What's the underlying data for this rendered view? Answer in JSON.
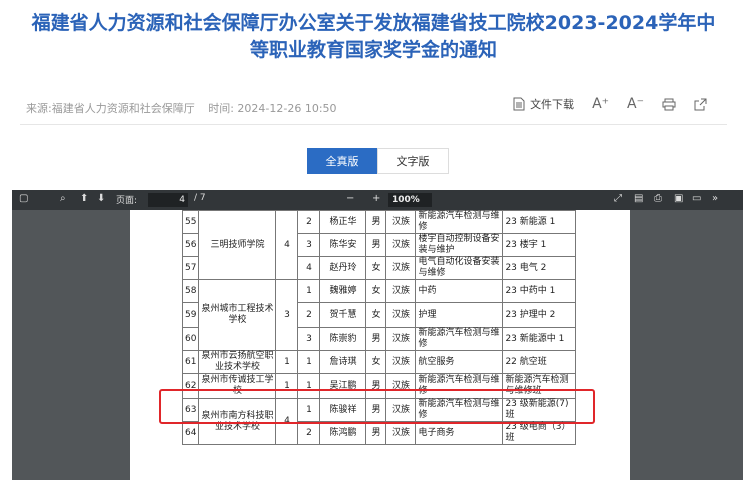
{
  "article": {
    "title_line1": "福建省人力资源和社会保障厅办公室关于发放福建省技工院校2023-2024学年中",
    "title_line2": "等职业教育国家奖学金的通知",
    "source": "来源:福建省人力资源和社会保障厅",
    "time": "时间:  2024-12-26 10:50"
  },
  "tools": {
    "download_label": "文件下载",
    "font_increase": "A⁺",
    "font_decrease": "A⁻"
  },
  "tabs": {
    "original": "全真版",
    "text": "文字版"
  },
  "viewer": {
    "page_label": "页面:",
    "page_current": "4",
    "page_total": "/ 7",
    "zoom": "100%"
  },
  "table_rows": [
    {
      "no": "55",
      "school": "三明技师学院",
      "count": "4",
      "idx": "2",
      "name": "杨正华",
      "sex": "男",
      "nation": "汉族",
      "major": "新能源汽车检测与维修",
      "cls": "23 新能源 1"
    },
    {
      "no": "56",
      "school": "",
      "count": "",
      "idx": "3",
      "name": "陈华安",
      "sex": "男",
      "nation": "汉族",
      "major": "楼宇自动控制设备安装与维护",
      "cls": "23 楼宇 1"
    },
    {
      "no": "57",
      "school": "",
      "count": "",
      "idx": "4",
      "name": "赵丹玲",
      "sex": "女",
      "nation": "汉族",
      "major": "电气自动化设备安装与维修",
      "cls": "23 电气 2"
    },
    {
      "no": "58",
      "school": "泉州城市工程技术学校",
      "count": "3",
      "idx": "1",
      "name": "魏雅婷",
      "sex": "女",
      "nation": "汉族",
      "major": "中药",
      "cls": "23 中药中 1"
    },
    {
      "no": "59",
      "school": "",
      "count": "",
      "idx": "2",
      "name": "贺千慧",
      "sex": "女",
      "nation": "汉族",
      "major": "护理",
      "cls": "23 护理中 2"
    },
    {
      "no": "60",
      "school": "",
      "count": "",
      "idx": "3",
      "name": "陈崇豹",
      "sex": "男",
      "nation": "汉族",
      "major": "新能源汽车检测与维修",
      "cls": "23 新能源中 1"
    },
    {
      "no": "61",
      "school": "泉州市云扬航空职业技术学校",
      "count": "1",
      "idx": "1",
      "name": "詹诗琪",
      "sex": "女",
      "nation": "汉族",
      "major": "航空服务",
      "cls": "22 航空班"
    },
    {
      "no": "62",
      "school": "泉州市传诚技工学校",
      "count": "1",
      "idx": "1",
      "name": "吴江鹏",
      "sex": "男",
      "nation": "汉族",
      "major": "新能源汽车检测与维修",
      "cls": "新能源汽车检测与维修班"
    },
    {
      "no": "63",
      "school": "泉州市南方科技职业技术学校",
      "count": "4",
      "idx": "1",
      "name": "陈骏祥",
      "sex": "男",
      "nation": "汉族",
      "major": "新能源汽车检测与维修",
      "cls": "23 级新能源(7)班"
    },
    {
      "no": "64",
      "school": "",
      "count": "",
      "idx": "2",
      "name": "陈鸿鹏",
      "sex": "男",
      "nation": "汉族",
      "major": "电子商务",
      "cls": "23 级电商（3）班"
    }
  ]
}
